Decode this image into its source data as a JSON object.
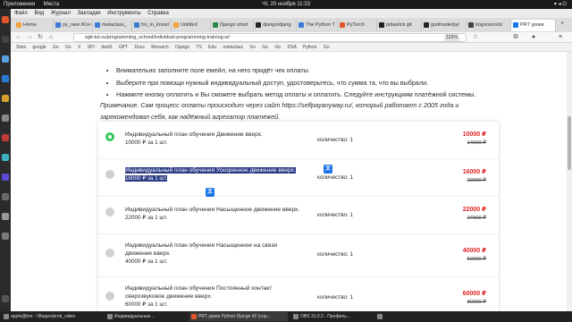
{
  "system": {
    "apps_label": "Приложения",
    "places_label": "Места",
    "clock": "Чт, 20 ноября  11:33"
  },
  "browser": {
    "menu": [
      "Файл",
      "Вид",
      "Журнал",
      "Закладки",
      "Инструменты",
      "Справка"
    ],
    "tabs": [
      {
        "label": "Home",
        "color": "#f2a33a"
      },
      {
        "label": "py_new /Kon",
        "color": "#3a7bd5"
      },
      {
        "label": "metaclass_",
        "color": "#3a7bd5"
      },
      {
        "label": "for_in_knowl",
        "color": "#3a7bd5"
      },
      {
        "label": "Untitled",
        "color": "#f2a33a"
      },
      {
        "label": "Django short",
        "color": "#2a8a4a"
      },
      {
        "label": "django/djang",
        "color": "#222222"
      },
      {
        "label": "The Python T",
        "color": "#3a7bd5"
      },
      {
        "label": "PyTorch",
        "color": "#e0562a"
      },
      {
        "label": "pidastick git",
        "color": "#222222"
      },
      {
        "label": "godmode/pyt",
        "color": "#222222"
      },
      {
        "label": "tiogo/zero/st",
        "color": "#444444"
      },
      {
        "label": "PRT уроки",
        "color": "#1a73e8",
        "active": true
      }
    ],
    "url": "sgb-tut.ru/programming_school/individual-programming-training-w/",
    "zoom": "133%",
    "bookmarks": [
      "Sites",
      "google",
      "",
      "Go",
      "Go",
      "X",
      "SPI",
      "dext5",
      "GPT",
      "Docs",
      "Monarch",
      "Django",
      "TS",
      "Edu",
      "metaclass",
      "Go",
      "Go",
      "Go",
      "DSA",
      "Python",
      "Go"
    ]
  },
  "content": {
    "bullets": [
      "Внимательно заполните поле емейл, на него придёт чек оплаты.",
      "Выберите при помощи нужный индивидуальный доступ, удостоверьтесь, что сумма та, что вы выбрали.",
      "Нажмите кнопку оплатить и Вы сможете выбрать метод оплаты и оплатить. Следуйте инструкциям платёжной системы."
    ],
    "note_line1": "Примечание. Сам процесс оплаты происходит через сайт https://selfpayanyway.ru/, который работает с 2005 года и",
    "note_line2": "зарекомендовал себя, как надёжный агрегатор платежей.",
    "plans": [
      {
        "name": "Индивидуальный план обучения Движение вверх.",
        "price_line": "10000 ₽ за 1 шт.",
        "qty": "количество: 1",
        "price_new": "10000 ₽",
        "price_old": "14000 ₽",
        "selected": true
      },
      {
        "name": "Индивидуальный план обучения Ускоренное движение вверх.",
        "price_line": "16000 ₽ за 1 шт.",
        "qty": "количество: 1",
        "price_new": "16000 ₽",
        "price_old": "20000 ₽",
        "selected": false,
        "highlighted": true
      },
      {
        "name": "Индивидуальный план обучения Насыщенное движение вверх.",
        "price_line": "22000 ₽ за 1 шт.",
        "qty": "количество: 1",
        "price_new": "22000 ₽",
        "price_old": "27000 ₽",
        "selected": false
      },
      {
        "name": "Индивидуальный план обучения Насыщенное на связи движение вверх.",
        "price_line": "40000 ₽ за 1 шт.",
        "qty": "количество: 1",
        "price_new": "40000 ₽",
        "price_old": "50000 ₽",
        "selected": false
      },
      {
        "name": "Индивидуальный план обучения Постоянный контакт сверхзвуковое движение вверх.",
        "price_line": "60000 ₽ за 1 шт.",
        "qty": "количество: 1",
        "price_new": "60000 ₽",
        "price_old": "80000 ₽",
        "selected": false
      }
    ]
  },
  "taskbar": [
    {
      "label": "apple@bm: ~/Видео/prob_video"
    },
    {
      "label": "Индивидуальные..."
    },
    {
      "label": "PRT уроки Python Django 42 (сор..."
    },
    {
      "label": "OBS 31.0.2 - Профиль..."
    },
    {
      "label": ""
    }
  ],
  "colors": {
    "accent": "#34c759",
    "price_red": "#e02424",
    "selection": "#2a3b86"
  }
}
